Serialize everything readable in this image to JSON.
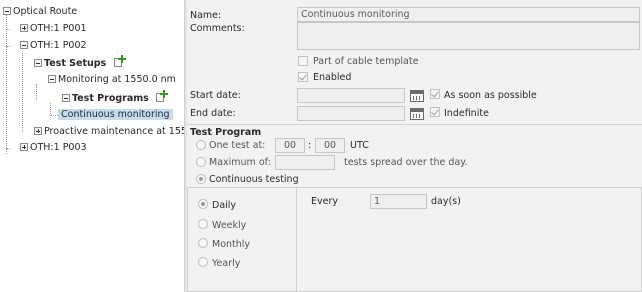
{
  "tree": {
    "root": "Optical Route",
    "oth1": "OTH:1 P001",
    "oth2": "OTH:1 P002",
    "test_setups": "Test Setups",
    "monitoring": "Monitoring at 1550.0 nm",
    "test_programs": "Test Programs",
    "continuous": "Continuous monitoring",
    "proactive": "Proactive maintenance at 155",
    "oth3": "OTH:1 P003"
  },
  "form": {
    "name_label": "Name:",
    "name_value": "Continuous monitoring",
    "comments_label": "Comments:",
    "comments_value": "",
    "cable_template_label": "Part of cable template",
    "cable_template_checked": false,
    "enabled_label": "Enabled",
    "enabled_checked": true,
    "start_date_label": "Start date:",
    "start_date_value": "",
    "asap_label": "As soon as possible",
    "asap_checked": true,
    "end_date_label": "End date:",
    "end_date_value": "",
    "indefinite_label": "Indefinite",
    "indefinite_checked": true
  },
  "test_program": {
    "title": "Test Program",
    "one_test_label": "One test at:",
    "hour": "00",
    "colon": ":",
    "minute": "00",
    "utc": "UTC",
    "maximum_label": "Maximum of:",
    "maximum_value": "",
    "spread_label": "tests spread over the day.",
    "continuous_label": "Continuous testing",
    "selected_mode": "continuous"
  },
  "recurrence": {
    "daily": "Daily",
    "weekly": "Weekly",
    "monthly": "Monthly",
    "yearly": "Yearly",
    "selected": "daily",
    "every_label": "Every",
    "every_value": "1",
    "unit": "day(s)"
  }
}
